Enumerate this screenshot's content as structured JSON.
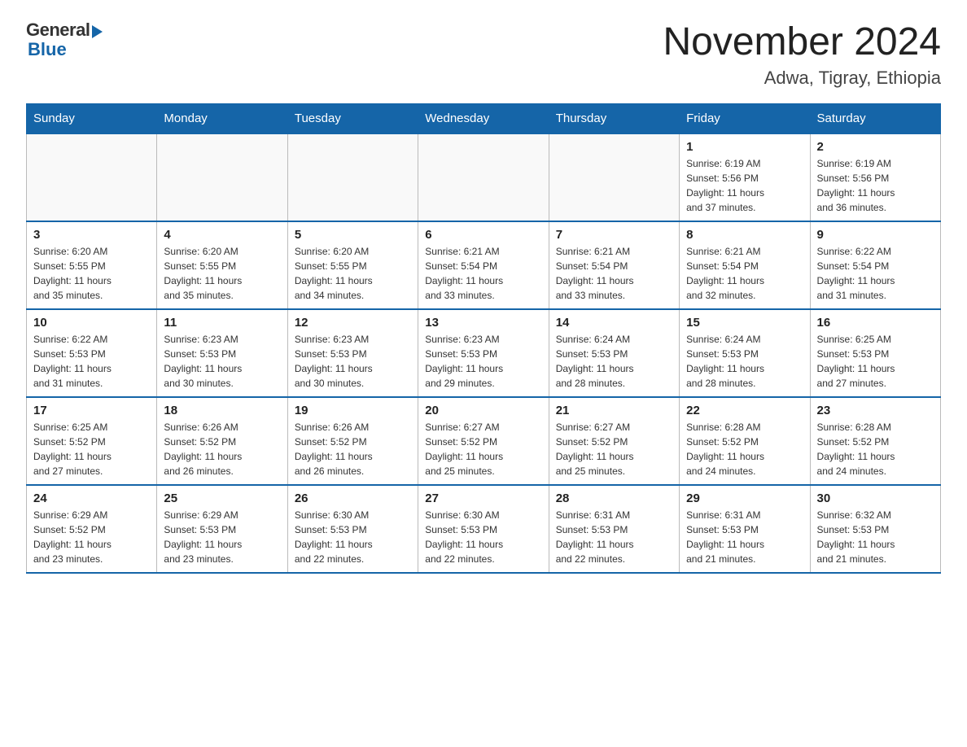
{
  "logo": {
    "general": "General",
    "blue": "Blue"
  },
  "title": "November 2024",
  "subtitle": "Adwa, Tigray, Ethiopia",
  "days_of_week": [
    "Sunday",
    "Monday",
    "Tuesday",
    "Wednesday",
    "Thursday",
    "Friday",
    "Saturday"
  ],
  "weeks": [
    [
      {
        "day": "",
        "info": ""
      },
      {
        "day": "",
        "info": ""
      },
      {
        "day": "",
        "info": ""
      },
      {
        "day": "",
        "info": ""
      },
      {
        "day": "",
        "info": ""
      },
      {
        "day": "1",
        "info": "Sunrise: 6:19 AM\nSunset: 5:56 PM\nDaylight: 11 hours\nand 37 minutes."
      },
      {
        "day": "2",
        "info": "Sunrise: 6:19 AM\nSunset: 5:56 PM\nDaylight: 11 hours\nand 36 minutes."
      }
    ],
    [
      {
        "day": "3",
        "info": "Sunrise: 6:20 AM\nSunset: 5:55 PM\nDaylight: 11 hours\nand 35 minutes."
      },
      {
        "day": "4",
        "info": "Sunrise: 6:20 AM\nSunset: 5:55 PM\nDaylight: 11 hours\nand 35 minutes."
      },
      {
        "day": "5",
        "info": "Sunrise: 6:20 AM\nSunset: 5:55 PM\nDaylight: 11 hours\nand 34 minutes."
      },
      {
        "day": "6",
        "info": "Sunrise: 6:21 AM\nSunset: 5:54 PM\nDaylight: 11 hours\nand 33 minutes."
      },
      {
        "day": "7",
        "info": "Sunrise: 6:21 AM\nSunset: 5:54 PM\nDaylight: 11 hours\nand 33 minutes."
      },
      {
        "day": "8",
        "info": "Sunrise: 6:21 AM\nSunset: 5:54 PM\nDaylight: 11 hours\nand 32 minutes."
      },
      {
        "day": "9",
        "info": "Sunrise: 6:22 AM\nSunset: 5:54 PM\nDaylight: 11 hours\nand 31 minutes."
      }
    ],
    [
      {
        "day": "10",
        "info": "Sunrise: 6:22 AM\nSunset: 5:53 PM\nDaylight: 11 hours\nand 31 minutes."
      },
      {
        "day": "11",
        "info": "Sunrise: 6:23 AM\nSunset: 5:53 PM\nDaylight: 11 hours\nand 30 minutes."
      },
      {
        "day": "12",
        "info": "Sunrise: 6:23 AM\nSunset: 5:53 PM\nDaylight: 11 hours\nand 30 minutes."
      },
      {
        "day": "13",
        "info": "Sunrise: 6:23 AM\nSunset: 5:53 PM\nDaylight: 11 hours\nand 29 minutes."
      },
      {
        "day": "14",
        "info": "Sunrise: 6:24 AM\nSunset: 5:53 PM\nDaylight: 11 hours\nand 28 minutes."
      },
      {
        "day": "15",
        "info": "Sunrise: 6:24 AM\nSunset: 5:53 PM\nDaylight: 11 hours\nand 28 minutes."
      },
      {
        "day": "16",
        "info": "Sunrise: 6:25 AM\nSunset: 5:53 PM\nDaylight: 11 hours\nand 27 minutes."
      }
    ],
    [
      {
        "day": "17",
        "info": "Sunrise: 6:25 AM\nSunset: 5:52 PM\nDaylight: 11 hours\nand 27 minutes."
      },
      {
        "day": "18",
        "info": "Sunrise: 6:26 AM\nSunset: 5:52 PM\nDaylight: 11 hours\nand 26 minutes."
      },
      {
        "day": "19",
        "info": "Sunrise: 6:26 AM\nSunset: 5:52 PM\nDaylight: 11 hours\nand 26 minutes."
      },
      {
        "day": "20",
        "info": "Sunrise: 6:27 AM\nSunset: 5:52 PM\nDaylight: 11 hours\nand 25 minutes."
      },
      {
        "day": "21",
        "info": "Sunrise: 6:27 AM\nSunset: 5:52 PM\nDaylight: 11 hours\nand 25 minutes."
      },
      {
        "day": "22",
        "info": "Sunrise: 6:28 AM\nSunset: 5:52 PM\nDaylight: 11 hours\nand 24 minutes."
      },
      {
        "day": "23",
        "info": "Sunrise: 6:28 AM\nSunset: 5:52 PM\nDaylight: 11 hours\nand 24 minutes."
      }
    ],
    [
      {
        "day": "24",
        "info": "Sunrise: 6:29 AM\nSunset: 5:52 PM\nDaylight: 11 hours\nand 23 minutes."
      },
      {
        "day": "25",
        "info": "Sunrise: 6:29 AM\nSunset: 5:53 PM\nDaylight: 11 hours\nand 23 minutes."
      },
      {
        "day": "26",
        "info": "Sunrise: 6:30 AM\nSunset: 5:53 PM\nDaylight: 11 hours\nand 22 minutes."
      },
      {
        "day": "27",
        "info": "Sunrise: 6:30 AM\nSunset: 5:53 PM\nDaylight: 11 hours\nand 22 minutes."
      },
      {
        "day": "28",
        "info": "Sunrise: 6:31 AM\nSunset: 5:53 PM\nDaylight: 11 hours\nand 22 minutes."
      },
      {
        "day": "29",
        "info": "Sunrise: 6:31 AM\nSunset: 5:53 PM\nDaylight: 11 hours\nand 21 minutes."
      },
      {
        "day": "30",
        "info": "Sunrise: 6:32 AM\nSunset: 5:53 PM\nDaylight: 11 hours\nand 21 minutes."
      }
    ]
  ]
}
